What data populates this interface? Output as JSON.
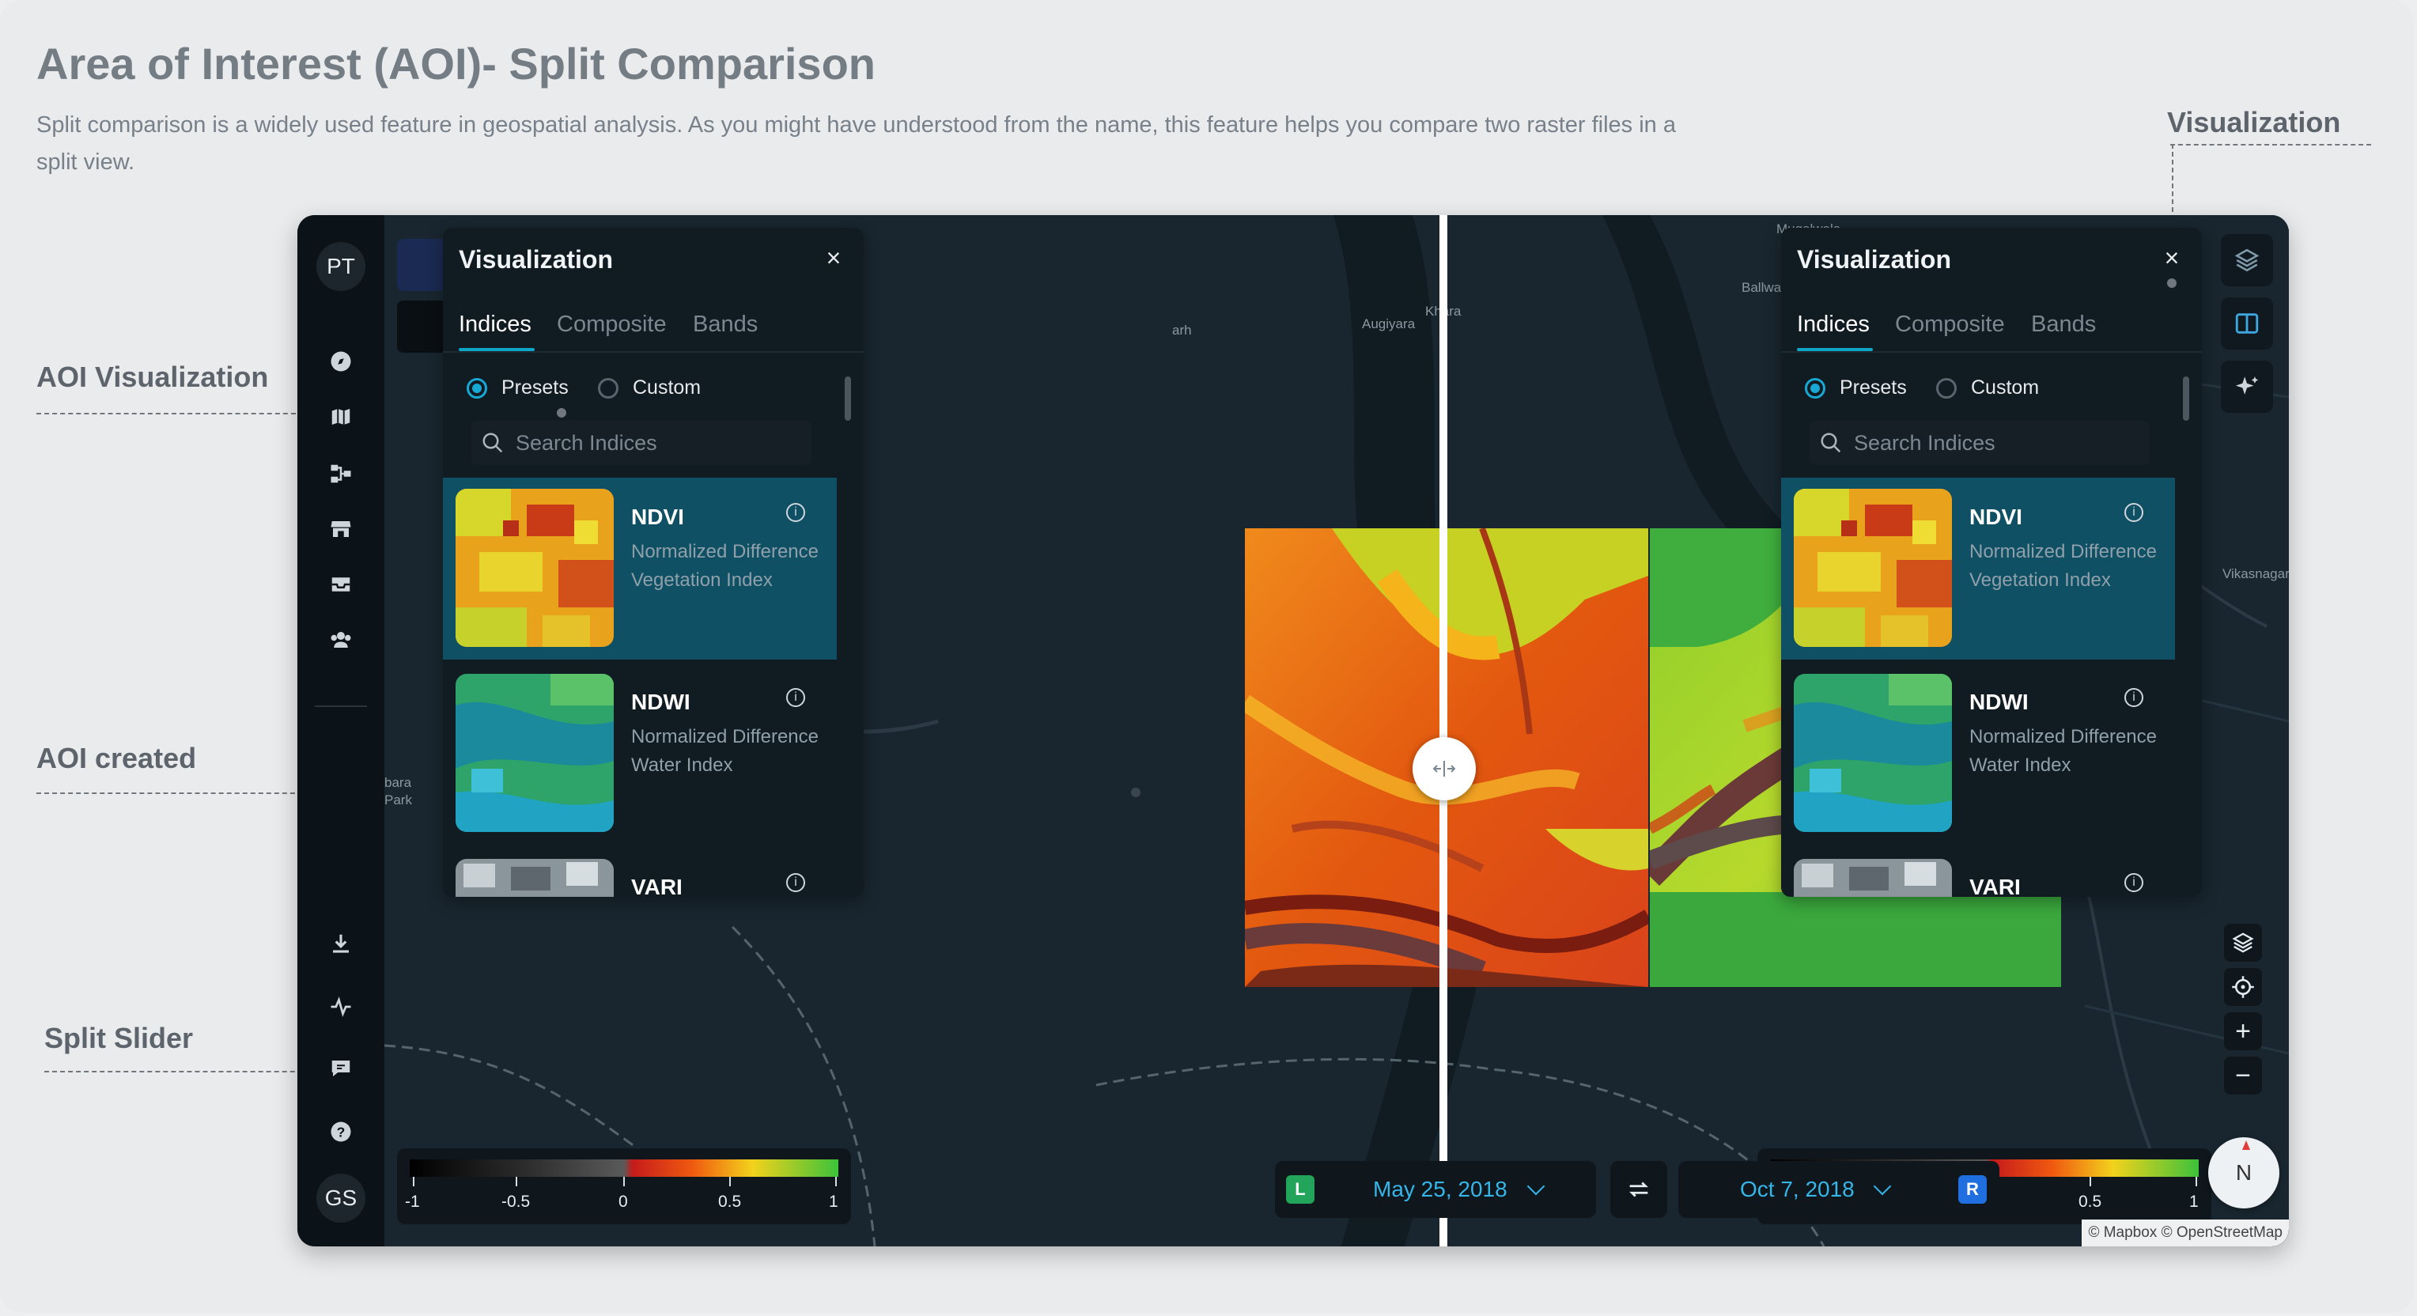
{
  "page": {
    "title": "Area of Interest (AOI)- Split Comparison",
    "description": "Split comparison is a widely used feature in geospatial analysis. As you might have understood from the name, this feature helps you compare two raster files in a split view."
  },
  "annotations": {
    "aoi_visualization": "AOI Visualization",
    "aoi_created": "AOI created",
    "split_slider": "Split Slider",
    "visualization": "Visualization"
  },
  "sidebar": {
    "top_avatar": "PT",
    "bottom_avatar": "GS",
    "icons": [
      "compass-icon",
      "map-icon",
      "workflow-icon",
      "store-icon",
      "inbox-icon",
      "team-icon",
      "download-icon",
      "activity-icon",
      "feedback-icon",
      "help-icon",
      "docs-icon"
    ]
  },
  "map": {
    "places": [
      "Mugalwala",
      "Ballwala",
      "Khara",
      "Augiyara",
      "arh",
      "bara",
      "Park",
      "Vikasnagar"
    ],
    "attribution": "© Mapbox © OpenStreetMap",
    "compass_label": "N",
    "controls": {
      "zoom_in": "+",
      "zoom_out": "−"
    }
  },
  "panel_left": {
    "title": "Visualization",
    "close": "×",
    "tabs": [
      "Indices",
      "Composite",
      "Bands"
    ],
    "active_tab": "Indices",
    "radio_presets": "Presets",
    "radio_custom": "Custom",
    "selected_mode": "Presets",
    "search_placeholder": "Search Indices",
    "items": [
      {
        "name": "NDVI",
        "desc": "Normalized Difference Vegetation Index"
      },
      {
        "name": "NDWI",
        "desc": "Normalized Difference Water Index"
      },
      {
        "name": "VARI",
        "desc": ""
      }
    ]
  },
  "panel_right": {
    "title": "Visualization",
    "close": "×",
    "tabs": [
      "Indices",
      "Composite",
      "Bands"
    ],
    "active_tab": "Indices",
    "radio_presets": "Presets",
    "radio_custom": "Custom",
    "selected_mode": "Presets",
    "search_placeholder": "Search Indices",
    "items": [
      {
        "name": "NDVI",
        "desc": "Normalized Difference Vegetation Index"
      },
      {
        "name": "NDWI",
        "desc": "Normalized Difference Water Index"
      },
      {
        "name": "VARI",
        "desc": ""
      }
    ]
  },
  "legend": {
    "labels": [
      "-1",
      "-0.5",
      "0",
      "0.5",
      "1"
    ]
  },
  "split": {
    "left_badge": "L",
    "left_date": "May 25, 2018",
    "right_badge": "R",
    "right_date": "Oct 7, 2018"
  },
  "colors": {
    "accent": "#0ea5c6",
    "date_text": "#35b5e8",
    "left_badge": "#22a45a",
    "right_badge": "#1f6fe0",
    "selected_item": "#0f5065"
  }
}
